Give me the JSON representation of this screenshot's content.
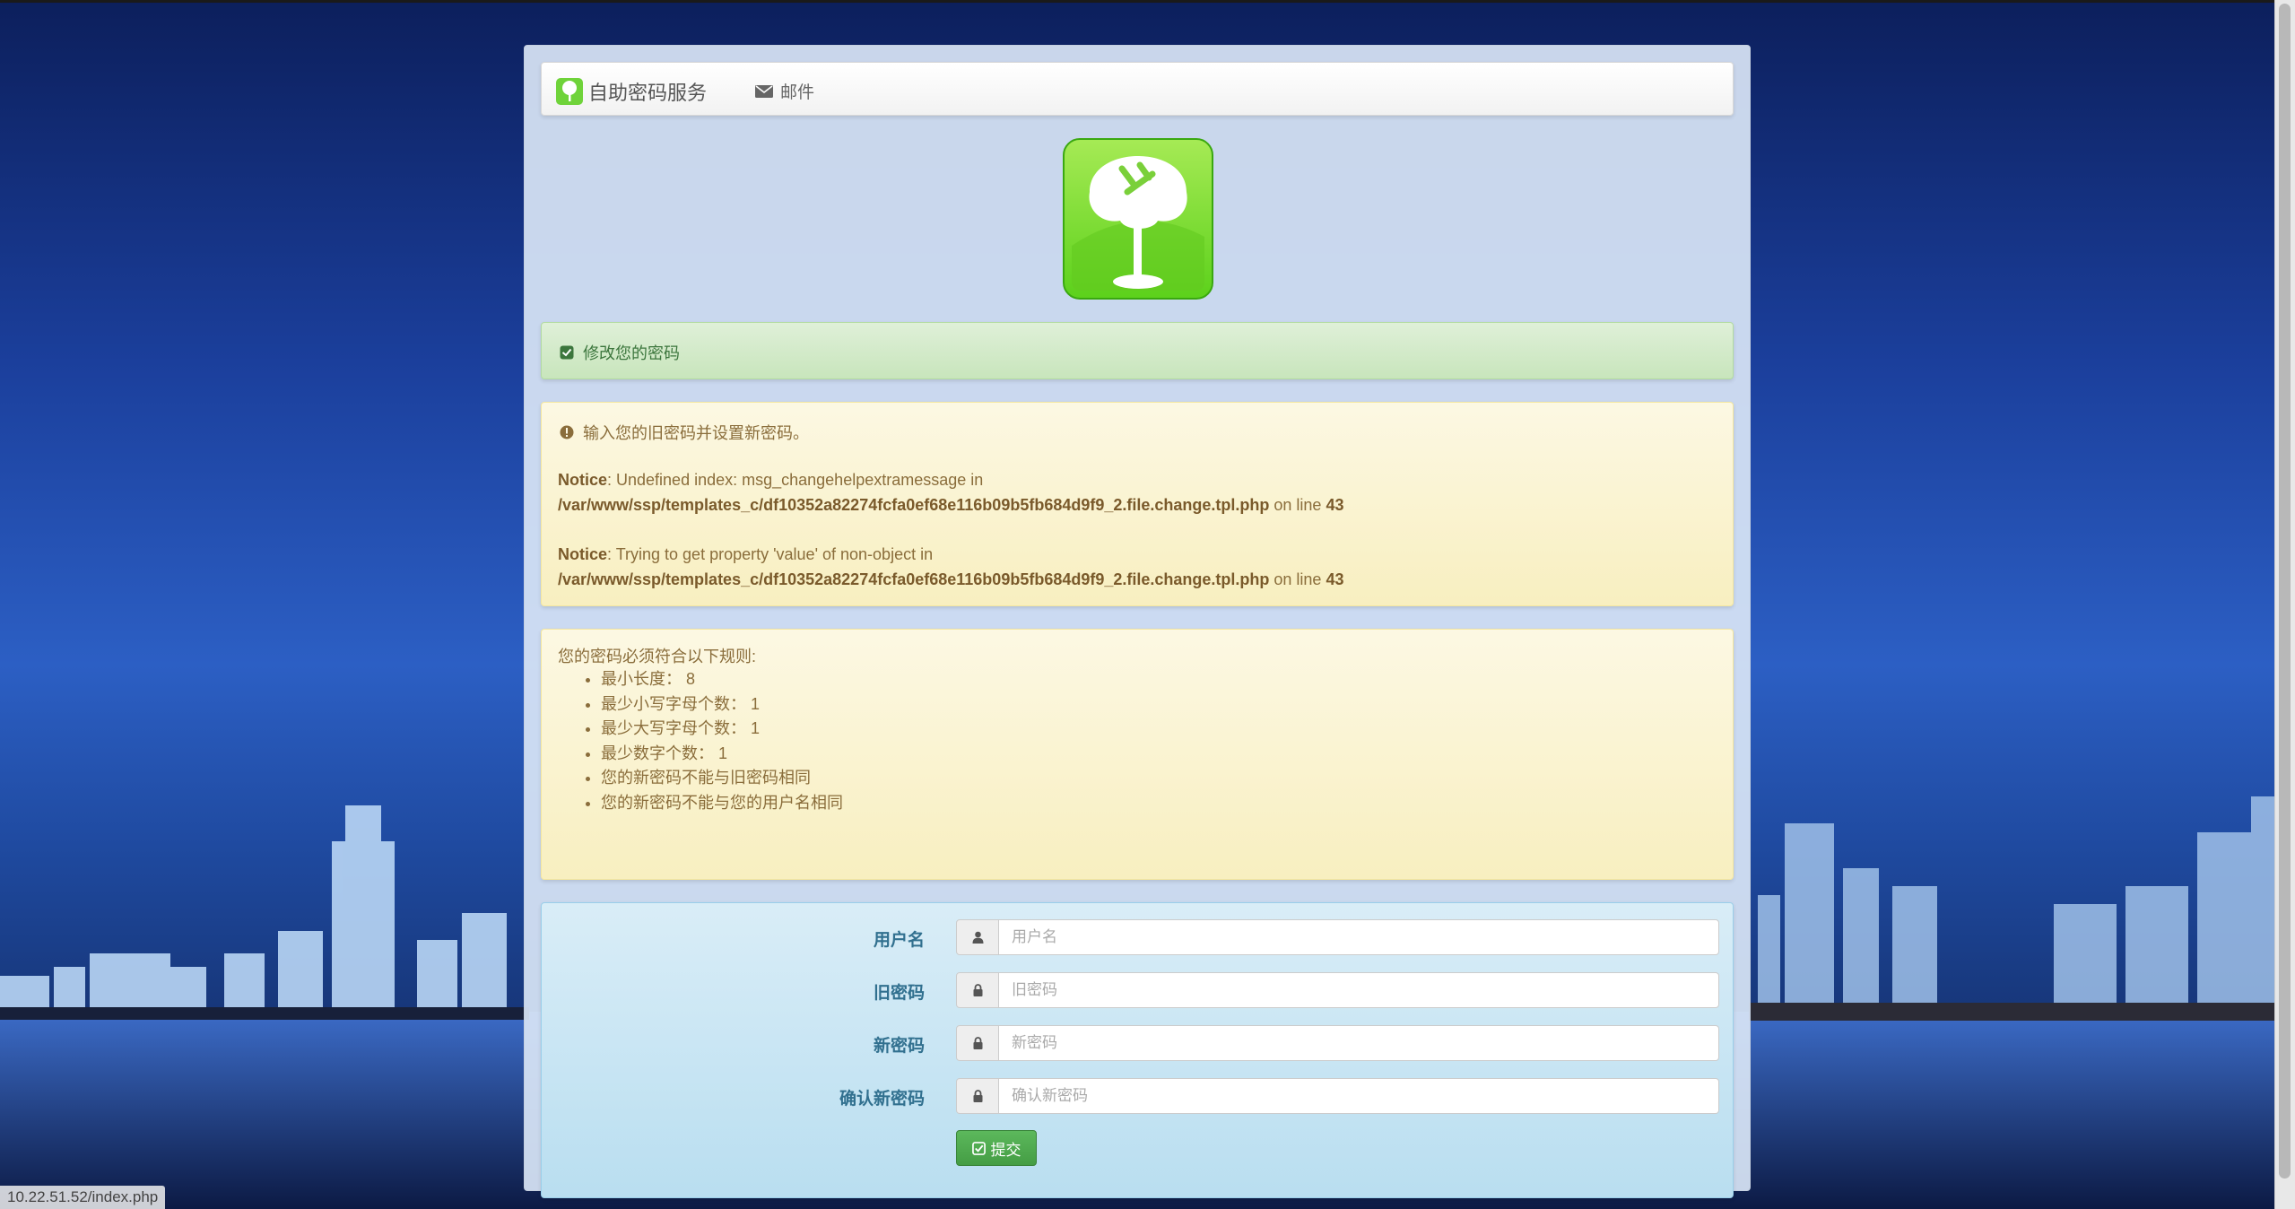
{
  "navbar": {
    "brand": "自助密码服务",
    "brand_icon": "tree-logo-icon",
    "mail_link": "邮件",
    "mail_icon": "envelope-icon"
  },
  "success_alert": {
    "text": "修改您的密码",
    "icon": "check-square-icon"
  },
  "info_alert": {
    "text": "输入您的旧密码并设置新密码。",
    "icon": "exclamation-circle-icon",
    "notices": [
      {
        "label": "Notice",
        "message": ": Undefined index: msg_changehelpextramessage in",
        "file": "/var/www/ssp/templates_c/df10352a82274fcfa0ef68e116b09b5fb684d9f9_2.file.change.tpl.php",
        "online": " on line ",
        "line": "43"
      },
      {
        "label": "Notice",
        "message": ": Trying to get property 'value' of non-object in",
        "file": "/var/www/ssp/templates_c/df10352a82274fcfa0ef68e116b09b5fb684d9f9_2.file.change.tpl.php",
        "online": " on line ",
        "line": "43"
      }
    ]
  },
  "rules_alert": {
    "title": "您的密码必须符合以下规则:",
    "rules": [
      "最小长度： 8",
      "最少小写字母个数： 1",
      "最少大写字母个数： 1",
      "最少数字个数： 1",
      "您的新密码不能与旧密码相同",
      "您的新密码不能与您的用户名相同"
    ]
  },
  "form": {
    "fields": [
      {
        "label": "用户名",
        "placeholder": "用户名",
        "icon": "user-icon"
      },
      {
        "label": "旧密码",
        "placeholder": "旧密码",
        "icon": "lock-icon"
      },
      {
        "label": "新密码",
        "placeholder": "新密码",
        "icon": "lock-icon"
      },
      {
        "label": "确认新密码",
        "placeholder": "确认新密码",
        "icon": "lock-icon"
      }
    ],
    "submit_label": "提交",
    "submit_icon": "check-square-icon"
  },
  "statusbar": {
    "url": "10.22.51.52/index.php"
  },
  "colors": {
    "success_bg": "#dff0d8",
    "warning_bg": "#fcf8e3",
    "info_bg": "#d9edf7",
    "button_green": "#5cb85c"
  }
}
